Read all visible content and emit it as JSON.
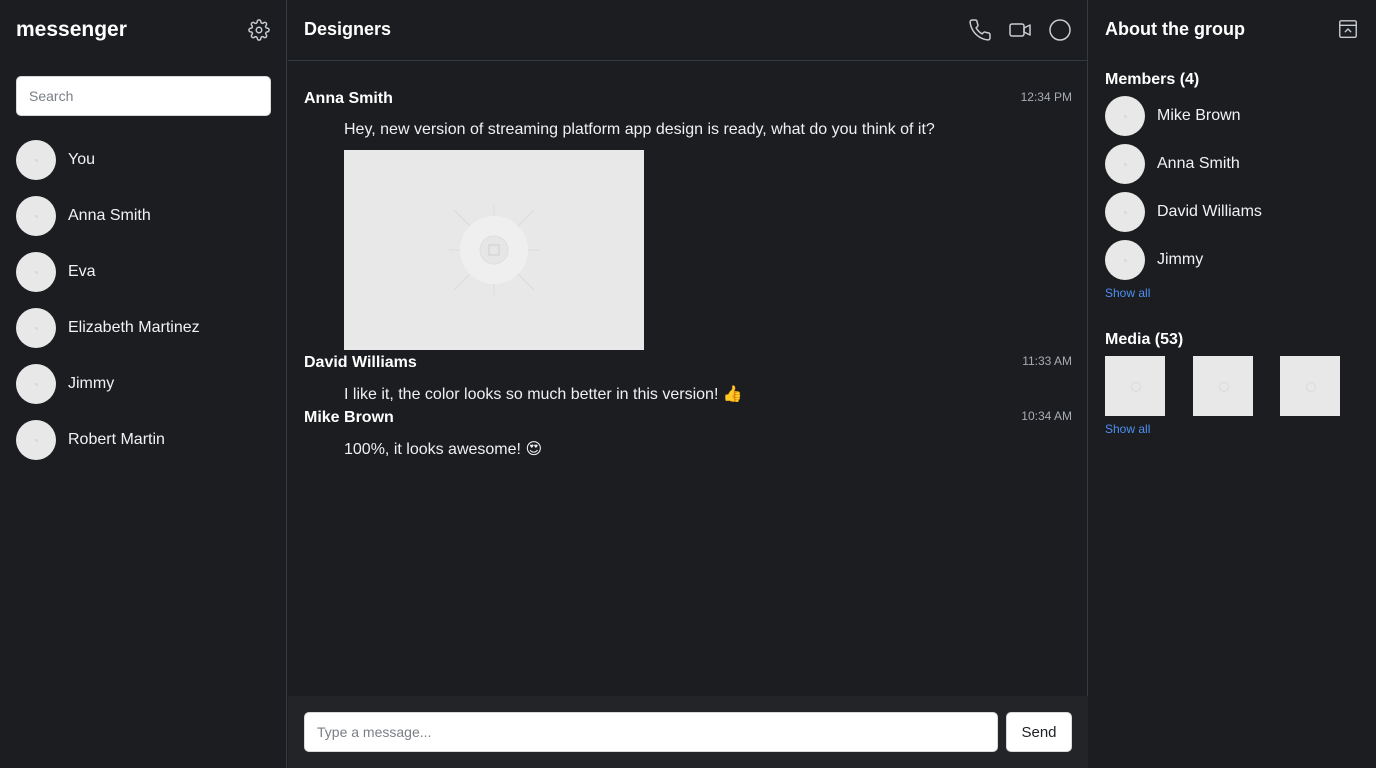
{
  "sidebar": {
    "brand": "messenger",
    "settings_icon": "gear-icon",
    "search_placeholder": "Search",
    "contacts": [
      {
        "name": "You"
      },
      {
        "name": "Anna Smith"
      },
      {
        "name": "Eva"
      },
      {
        "name": "Elizabeth Martinez"
      },
      {
        "name": "Jimmy"
      },
      {
        "name": "Robert Martin"
      }
    ]
  },
  "chat": {
    "title": "Designers",
    "header_icons": [
      "phone-icon",
      "video-camera-icon",
      "circle-icon"
    ],
    "messages": [
      {
        "author": "Anna Smith",
        "time": "12:34 PM",
        "text": "Hey, new version of streaming platform app design is ready, what do you think of it?",
        "has_image": true
      },
      {
        "author": "David Williams",
        "time": "11:33 AM",
        "text": "I like it, the color looks so much better in this version!",
        "emoji": "👍"
      },
      {
        "author": "Mike Brown",
        "time": "10:34 AM",
        "text": "100%, it looks awesome!",
        "emoji": "😍"
      }
    ],
    "composer": {
      "placeholder": "Type a message...",
      "send_label": "Send"
    }
  },
  "about": {
    "title": "About the group",
    "collapse_icon": "panel-collapse-icon",
    "members_title": "Members (4)",
    "members": [
      {
        "name": "Mike Brown"
      },
      {
        "name": "Anna Smith"
      },
      {
        "name": "David Williams"
      },
      {
        "name": "Jimmy"
      }
    ],
    "members_show_all": "Show all",
    "media_title": "Media (53)",
    "media_show_all": "Show all"
  },
  "colors": {
    "background": "#1b1d20",
    "divider": "#343a42",
    "link": "#4d8ff0",
    "placeholder": "#e8e8e8"
  }
}
